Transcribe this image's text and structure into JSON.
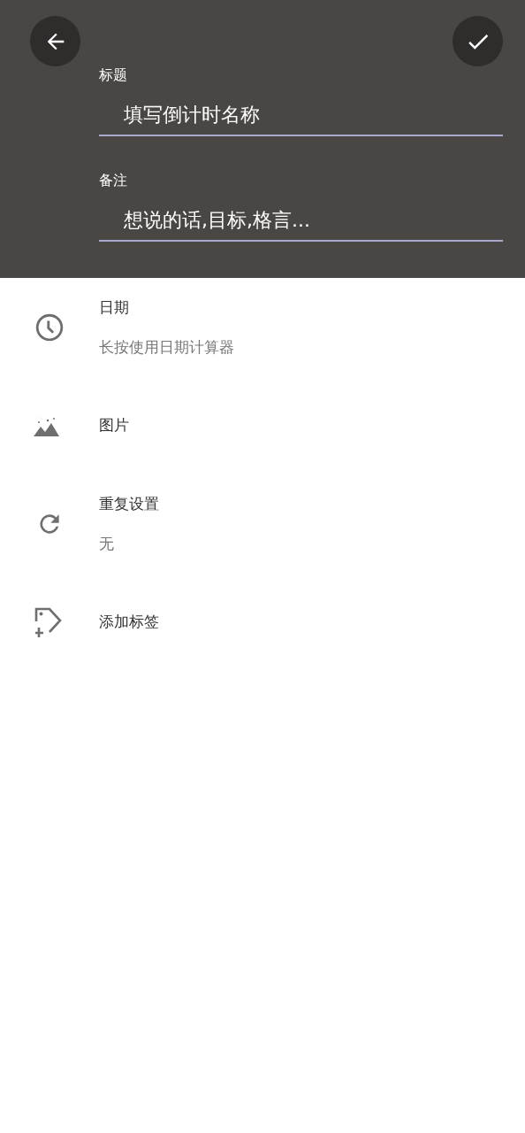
{
  "header": {
    "fields": [
      {
        "label": "标题",
        "placeholder": "填写倒计时名称"
      },
      {
        "label": "备注",
        "placeholder": "想说的话,目标,格言..."
      }
    ]
  },
  "options": [
    {
      "kind": "date",
      "title": "日期",
      "subtitle": "长按使用日期计算器"
    },
    {
      "kind": "picture",
      "title": "图片"
    },
    {
      "kind": "repeat",
      "title": "重复设置",
      "subtitle": "无"
    },
    {
      "kind": "tag",
      "title": "添加标签"
    }
  ]
}
